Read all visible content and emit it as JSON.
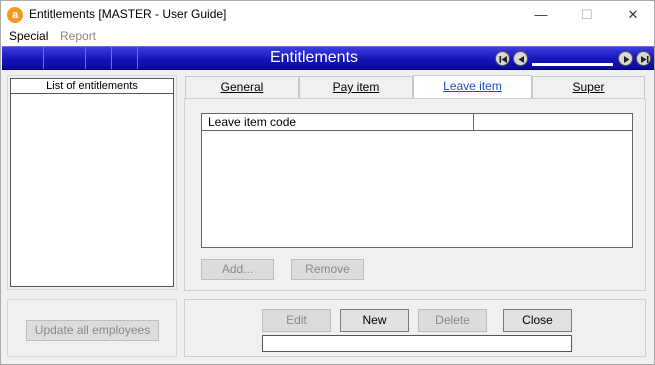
{
  "window": {
    "title": "Entitlements [MASTER - User Guide]",
    "app_icon_letter": "a",
    "controls": {
      "minimize": "—",
      "maximize": "☐",
      "close": "✕"
    }
  },
  "menu": {
    "special": "Special",
    "report": "Report"
  },
  "header": {
    "title": "Entitlements"
  },
  "left": {
    "list_header": "List of entitlements",
    "update_button": "Update all employees"
  },
  "tabs": [
    {
      "label": "General"
    },
    {
      "label": "Pay item"
    },
    {
      "label": "Leave item"
    },
    {
      "label": "Super"
    }
  ],
  "leave_panel": {
    "column_1": "Leave item code",
    "column_2": "",
    "add_button": "Add...",
    "remove_button": "Remove"
  },
  "actions": {
    "edit": "Edit",
    "new": "New",
    "delete": "Delete",
    "close": "Close",
    "status_text": ""
  },
  "colors": {
    "header_blue": "#1414b8",
    "active_tab_text": "#1a4fd0",
    "app_icon": "#f29a1b"
  }
}
